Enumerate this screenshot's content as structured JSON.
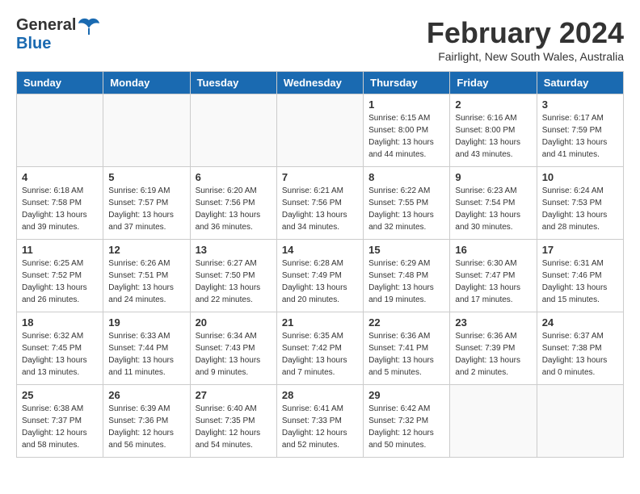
{
  "header": {
    "logo_general": "General",
    "logo_blue": "Blue",
    "month_year": "February 2024",
    "location": "Fairlight, New South Wales, Australia"
  },
  "days_of_week": [
    "Sunday",
    "Monday",
    "Tuesday",
    "Wednesday",
    "Thursday",
    "Friday",
    "Saturday"
  ],
  "weeks": [
    [
      {
        "day": "",
        "info": ""
      },
      {
        "day": "",
        "info": ""
      },
      {
        "day": "",
        "info": ""
      },
      {
        "day": "",
        "info": ""
      },
      {
        "day": "1",
        "info": "Sunrise: 6:15 AM\nSunset: 8:00 PM\nDaylight: 13 hours\nand 44 minutes."
      },
      {
        "day": "2",
        "info": "Sunrise: 6:16 AM\nSunset: 8:00 PM\nDaylight: 13 hours\nand 43 minutes."
      },
      {
        "day": "3",
        "info": "Sunrise: 6:17 AM\nSunset: 7:59 PM\nDaylight: 13 hours\nand 41 minutes."
      }
    ],
    [
      {
        "day": "4",
        "info": "Sunrise: 6:18 AM\nSunset: 7:58 PM\nDaylight: 13 hours\nand 39 minutes."
      },
      {
        "day": "5",
        "info": "Sunrise: 6:19 AM\nSunset: 7:57 PM\nDaylight: 13 hours\nand 37 minutes."
      },
      {
        "day": "6",
        "info": "Sunrise: 6:20 AM\nSunset: 7:56 PM\nDaylight: 13 hours\nand 36 minutes."
      },
      {
        "day": "7",
        "info": "Sunrise: 6:21 AM\nSunset: 7:56 PM\nDaylight: 13 hours\nand 34 minutes."
      },
      {
        "day": "8",
        "info": "Sunrise: 6:22 AM\nSunset: 7:55 PM\nDaylight: 13 hours\nand 32 minutes."
      },
      {
        "day": "9",
        "info": "Sunrise: 6:23 AM\nSunset: 7:54 PM\nDaylight: 13 hours\nand 30 minutes."
      },
      {
        "day": "10",
        "info": "Sunrise: 6:24 AM\nSunset: 7:53 PM\nDaylight: 13 hours\nand 28 minutes."
      }
    ],
    [
      {
        "day": "11",
        "info": "Sunrise: 6:25 AM\nSunset: 7:52 PM\nDaylight: 13 hours\nand 26 minutes."
      },
      {
        "day": "12",
        "info": "Sunrise: 6:26 AM\nSunset: 7:51 PM\nDaylight: 13 hours\nand 24 minutes."
      },
      {
        "day": "13",
        "info": "Sunrise: 6:27 AM\nSunset: 7:50 PM\nDaylight: 13 hours\nand 22 minutes."
      },
      {
        "day": "14",
        "info": "Sunrise: 6:28 AM\nSunset: 7:49 PM\nDaylight: 13 hours\nand 20 minutes."
      },
      {
        "day": "15",
        "info": "Sunrise: 6:29 AM\nSunset: 7:48 PM\nDaylight: 13 hours\nand 19 minutes."
      },
      {
        "day": "16",
        "info": "Sunrise: 6:30 AM\nSunset: 7:47 PM\nDaylight: 13 hours\nand 17 minutes."
      },
      {
        "day": "17",
        "info": "Sunrise: 6:31 AM\nSunset: 7:46 PM\nDaylight: 13 hours\nand 15 minutes."
      }
    ],
    [
      {
        "day": "18",
        "info": "Sunrise: 6:32 AM\nSunset: 7:45 PM\nDaylight: 13 hours\nand 13 minutes."
      },
      {
        "day": "19",
        "info": "Sunrise: 6:33 AM\nSunset: 7:44 PM\nDaylight: 13 hours\nand 11 minutes."
      },
      {
        "day": "20",
        "info": "Sunrise: 6:34 AM\nSunset: 7:43 PM\nDaylight: 13 hours\nand 9 minutes."
      },
      {
        "day": "21",
        "info": "Sunrise: 6:35 AM\nSunset: 7:42 PM\nDaylight: 13 hours\nand 7 minutes."
      },
      {
        "day": "22",
        "info": "Sunrise: 6:36 AM\nSunset: 7:41 PM\nDaylight: 13 hours\nand 5 minutes."
      },
      {
        "day": "23",
        "info": "Sunrise: 6:36 AM\nSunset: 7:39 PM\nDaylight: 13 hours\nand 2 minutes."
      },
      {
        "day": "24",
        "info": "Sunrise: 6:37 AM\nSunset: 7:38 PM\nDaylight: 13 hours\nand 0 minutes."
      }
    ],
    [
      {
        "day": "25",
        "info": "Sunrise: 6:38 AM\nSunset: 7:37 PM\nDaylight: 12 hours\nand 58 minutes."
      },
      {
        "day": "26",
        "info": "Sunrise: 6:39 AM\nSunset: 7:36 PM\nDaylight: 12 hours\nand 56 minutes."
      },
      {
        "day": "27",
        "info": "Sunrise: 6:40 AM\nSunset: 7:35 PM\nDaylight: 12 hours\nand 54 minutes."
      },
      {
        "day": "28",
        "info": "Sunrise: 6:41 AM\nSunset: 7:33 PM\nDaylight: 12 hours\nand 52 minutes."
      },
      {
        "day": "29",
        "info": "Sunrise: 6:42 AM\nSunset: 7:32 PM\nDaylight: 12 hours\nand 50 minutes."
      },
      {
        "day": "",
        "info": ""
      },
      {
        "day": "",
        "info": ""
      }
    ]
  ]
}
